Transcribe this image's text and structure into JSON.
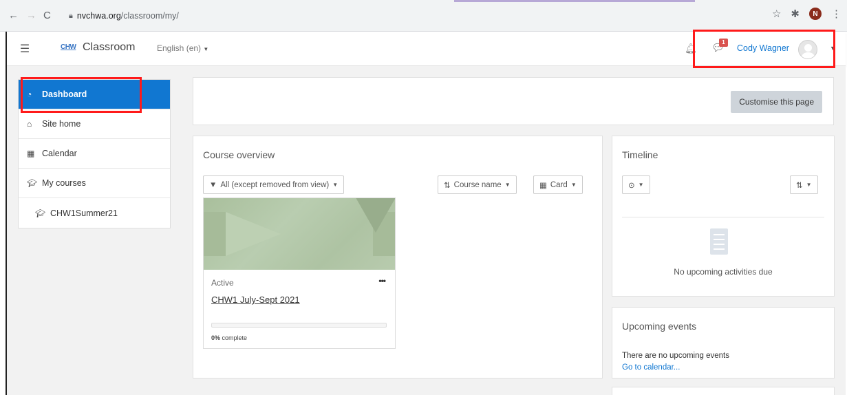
{
  "browser": {
    "url_domain": "nvchwa.org",
    "url_path": "/classroom/my/",
    "profile_initial": "N"
  },
  "navbar": {
    "logo_text": "CHW",
    "site_name": "Classroom",
    "language": "English (en)",
    "message_count": "1",
    "user_name": "Cody Wagner"
  },
  "sidebar": {
    "items": [
      {
        "label": "Dashboard",
        "icon": "dashboard-icon",
        "active": true
      },
      {
        "label": "Site home",
        "icon": "home-icon"
      },
      {
        "label": "Calendar",
        "icon": "calendar-icon"
      },
      {
        "label": "My courses",
        "icon": "graduation-cap-icon"
      },
      {
        "label": "CHW1Summer21",
        "icon": "graduation-cap-icon"
      }
    ]
  },
  "header_card": {
    "customise_button": "Customise this page"
  },
  "course_overview": {
    "title": "Course overview",
    "filter_label": "All (except removed from view)",
    "sort_label": "Course name",
    "view_label": "Card",
    "courses": [
      {
        "status": "Active",
        "name": "CHW1 July-Sept 2021",
        "progress": 0,
        "progress_percent": "0%",
        "progress_suffix": "complete"
      }
    ]
  },
  "timeline": {
    "title": "Timeline",
    "empty_message": "No upcoming activities due"
  },
  "upcoming_events": {
    "title": "Upcoming events",
    "empty_message": "There are no upcoming events",
    "calendar_link": "Go to calendar..."
  },
  "colors": {
    "accent": "#1177d1",
    "highlight_box": "#ff1a1a"
  }
}
